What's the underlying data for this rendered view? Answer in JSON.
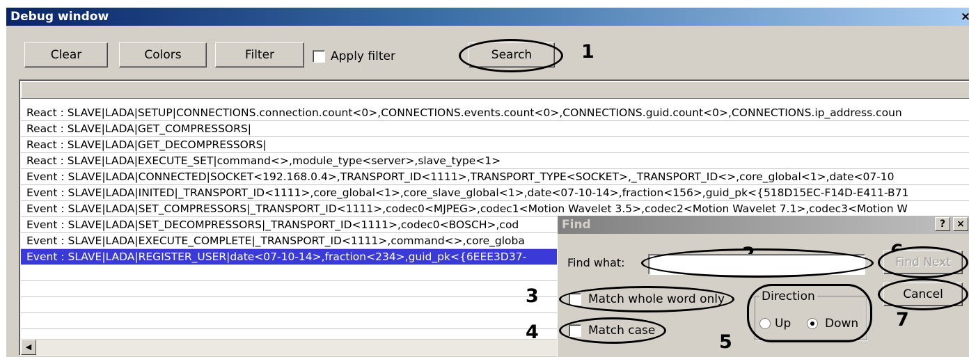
{
  "window": {
    "title": "Debug window",
    "close_glyph": "×"
  },
  "toolbar": {
    "clear_label": "Clear",
    "colors_label": "Colors",
    "filter_label": "Filter",
    "apply_filter_label": "Apply filter",
    "apply_filter_checked": false,
    "search_label": "Search"
  },
  "log": {
    "rows": [
      "React : SLAVE|LADA|SETUP|CONNECTIONS.connection.count<0>,CONNECTIONS.events.count<0>,CONNECTIONS.guid.count<0>,CONNECTIONS.ip_address.coun",
      "React : SLAVE|LADA|GET_COMPRESSORS|",
      "React : SLAVE|LADA|GET_DECOMPRESSORS|",
      "React : SLAVE|LADA|EXECUTE_SET|command<>,module_type<server>,slave_type<1>",
      "Event : SLAVE|LADA|CONNECTED|SOCKET<192.168.0.4>,TRANSPORT_ID<1111>,TRANSPORT_TYPE<SOCKET>,_TRANSPORT_ID<>,core_global<1>,date<07-10",
      "Event : SLAVE|LADA|INITED|_TRANSPORT_ID<1111>,core_global<1>,core_slave_global<1>,date<07-10-14>,fraction<156>,guid_pk<{518D15EC-F14D-E411-B71",
      "Event : SLAVE|LADA|SET_COMPRESSORS|_TRANSPORT_ID<1111>,codec0<MJPEG>,codec1<Motion Wavelet 3.5>,codec2<Motion Wavelet 7.1>,codec3<Motion W",
      "Event : SLAVE|LADA|SET_DECOMPRESSORS|_TRANSPORT_ID<1111>,codec0<BOSCH>,cod",
      "Event : SLAVE|LADA|EXECUTE_COMPLETE|_TRANSPORT_ID<1111>,command<>,core_globa",
      "Event : SLAVE|LADA|REGISTER_USER|date<07-10-14>,fraction<234>,guid_pk<{6EEE3D37-"
    ],
    "selected_index": 9,
    "scroll_left_glyph": "◀"
  },
  "find_dialog": {
    "title": "Find",
    "help_glyph": "?",
    "close_glyph": "×",
    "find_what_label": "Find what:",
    "find_what_value": "",
    "match_whole_word_label": "Match whole word only",
    "match_whole_word_checked": false,
    "match_case_label": "Match case",
    "match_case_checked": false,
    "direction_label": "Direction",
    "up_label": "Up",
    "down_label": "Down",
    "direction_selected": "Down",
    "find_next_label": "Find Next",
    "find_next_enabled": false,
    "cancel_label": "Cancel"
  },
  "annotations": {
    "n1": "1",
    "n2": "2",
    "n3": "3",
    "n4": "4",
    "n5": "5",
    "n6": "6",
    "n7": "7"
  }
}
